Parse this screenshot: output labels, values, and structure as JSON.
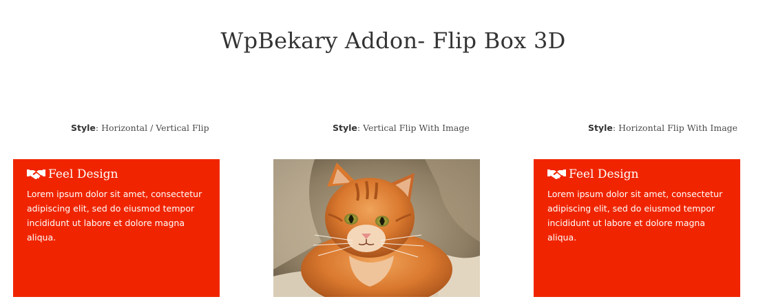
{
  "page": {
    "title": "WpBekary Addon- Flip Box 3D"
  },
  "styles": [
    {
      "label": "Style",
      "value": ": Horizontal / Vertical Flip"
    },
    {
      "label": "Style",
      "value": ": Vertical Flip With Image"
    },
    {
      "label": "Style",
      "value": ": Horizontal Flip With Image"
    }
  ],
  "boxes": [
    {
      "icon": "handshake-icon",
      "heading": "Feel Design",
      "text": "Lorem ipsum dolor sit amet, consectetur adipiscing elit, sed do eiusmod tempor incididunt ut labore et dolore magna aliqua."
    },
    {
      "icon": "handshake-icon",
      "heading": "Feel Design",
      "text": "Lorem ipsum dolor sit amet, consectetur adipiscing elit, sed do eiusmod tempor incididunt ut labore et dolore magna aliqua."
    }
  ],
  "image_box": {
    "subject": "orange-tabby-cat-photo"
  },
  "colors": {
    "accent": "#f02500",
    "text": "#333333",
    "background": "#ffffff"
  }
}
